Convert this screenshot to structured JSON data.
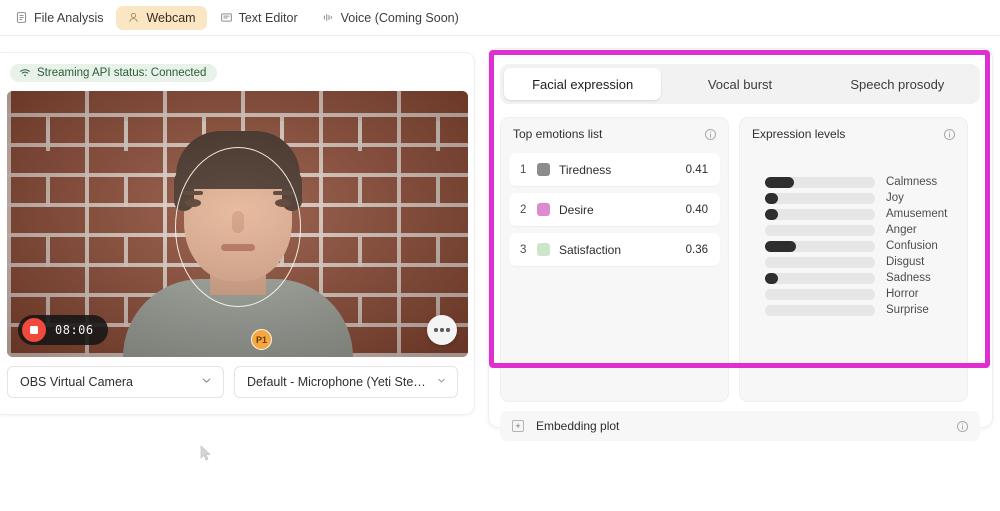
{
  "topbar": {
    "tabs": [
      {
        "label": "File Analysis",
        "icon": "document-icon",
        "active": false
      },
      {
        "label": "Webcam",
        "icon": "webcam-person-icon",
        "active": true
      },
      {
        "label": "Text Editor",
        "icon": "text-editor-icon",
        "active": false
      },
      {
        "label": "Voice (Coming Soon)",
        "icon": "voice-wave-icon",
        "active": false
      }
    ]
  },
  "left": {
    "status": {
      "icon": "wifi-icon",
      "text": "Streaming API status: Connected",
      "pill_bg": "#e8f2e8",
      "text_color": "#2f5b3b"
    },
    "video": {
      "overlay_badge": "P1",
      "recording": {
        "timer": "08:06",
        "stop_icon": "record-stop-icon"
      },
      "more_button": "more-options-icon"
    },
    "camera_select": {
      "value": "OBS Virtual Camera",
      "chevron": "chevron-down-icon"
    },
    "mic_select": {
      "value": "Default - Microphone (Yeti Stere...",
      "chevron": "chevron-down-icon"
    }
  },
  "right": {
    "tabs": [
      {
        "label": "Facial expression",
        "active": true
      },
      {
        "label": "Vocal burst",
        "active": false
      },
      {
        "label": "Speech prosody",
        "active": false
      }
    ],
    "emotions_card": {
      "title": "Top emotions list",
      "info_icon": "info-icon",
      "rows": [
        {
          "rank": "1",
          "name": "Tiredness",
          "score": "0.41",
          "color": "#8c8c8c"
        },
        {
          "rank": "2",
          "name": "Desire",
          "score": "0.40",
          "color": "#dd8ad0"
        },
        {
          "rank": "3",
          "name": "Satisfaction",
          "score": "0.36",
          "color": "#cde6cb"
        }
      ]
    },
    "levels_card": {
      "title": "Expression levels",
      "info_icon": "info-icon",
      "bar_color": "#2e2e2e",
      "track_color": "#e6e6e6",
      "levels": [
        {
          "label": "Calmness",
          "value": 0.26
        },
        {
          "label": "Joy",
          "value": 0.12
        },
        {
          "label": "Amusement",
          "value": 0.12
        },
        {
          "label": "Anger",
          "value": 0.0
        },
        {
          "label": "Confusion",
          "value": 0.28
        },
        {
          "label": "Disgust",
          "value": 0.0
        },
        {
          "label": "Sadness",
          "value": 0.12
        },
        {
          "label": "Horror",
          "value": 0.0
        },
        {
          "label": "Surprise",
          "value": 0.0
        }
      ]
    },
    "embedding": {
      "label": "Embedding plot",
      "expand_icon": "plus-box-icon",
      "info_icon": "info-icon"
    },
    "highlight_color": "#e02fd0"
  }
}
